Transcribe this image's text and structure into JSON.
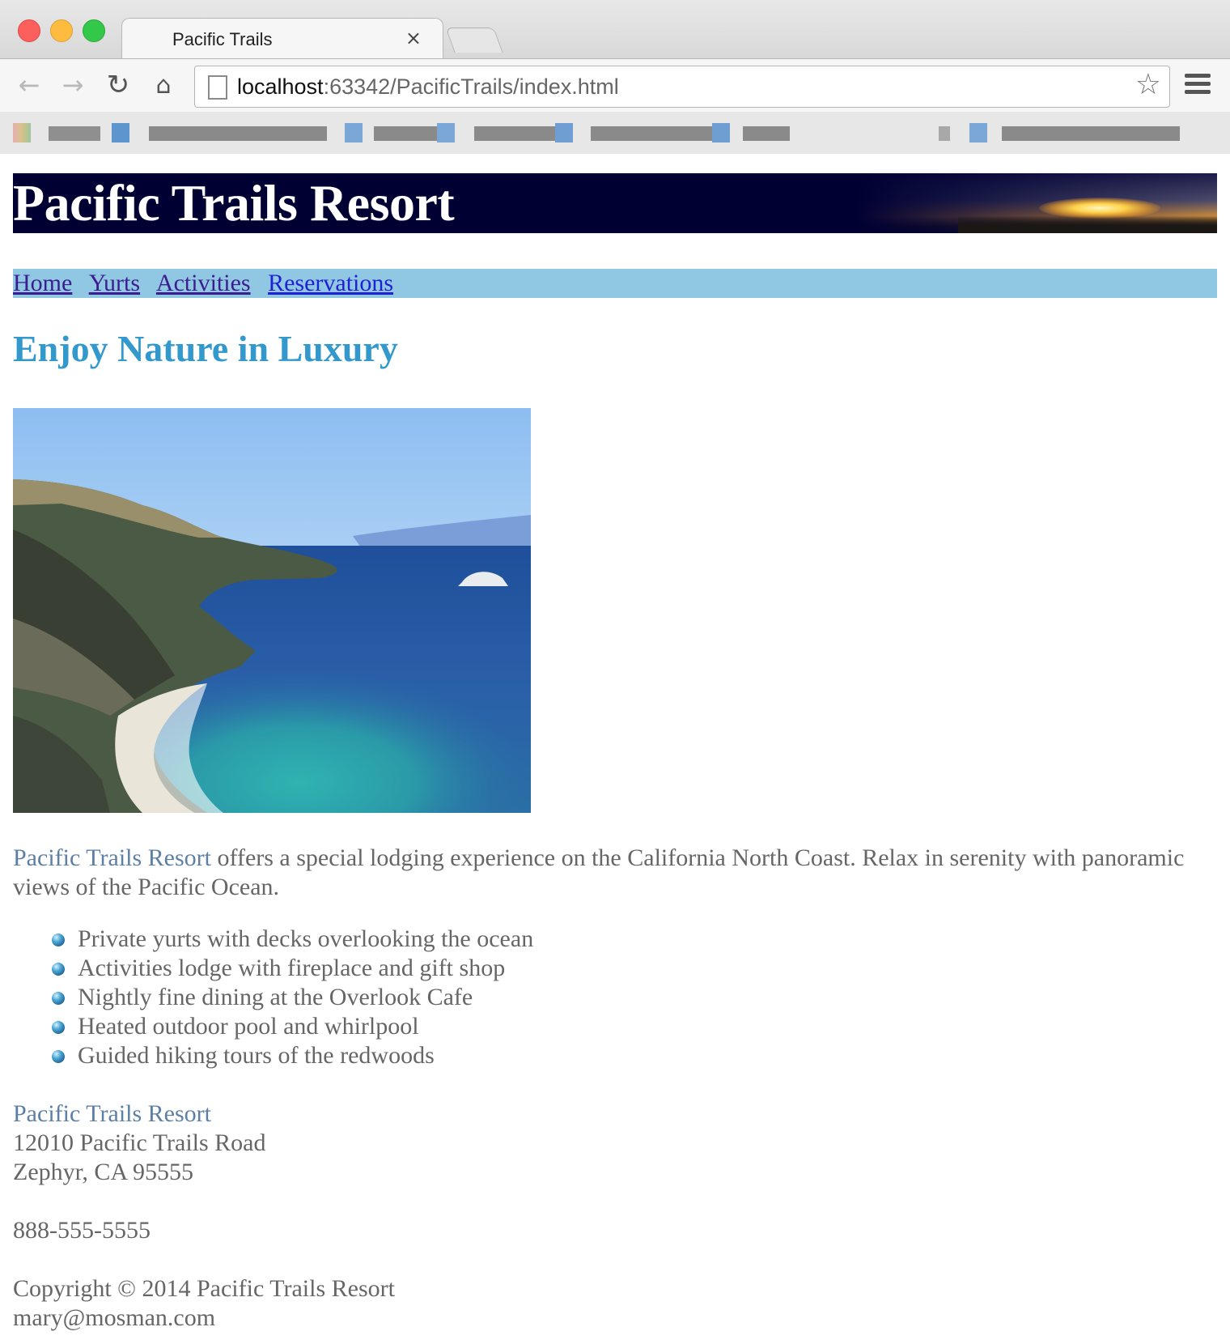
{
  "browser": {
    "tab_title": "Pacific Trails",
    "tab_close": "×",
    "url_host": "localhost",
    "url_rest": ":63342/PacificTrails/index.html"
  },
  "header": {
    "title": "Pacific Trails Resort"
  },
  "nav": {
    "items": [
      "Home",
      "Yurts",
      "Activities",
      "Reservations"
    ]
  },
  "main": {
    "heading": "Enjoy Nature in Luxury",
    "intro_highlight": "Pacific Trails Resort",
    "intro_text": " offers a special lodging experience on the California North Coast. Relax in serenity with panoramic views of the Pacific Ocean.",
    "features": [
      "Private yurts with decks overlooking the ocean",
      "Activities lodge with fireplace and gift shop",
      "Nightly fine dining at the Overlook Cafe",
      "Heated outdoor pool and whirlpool",
      "Guided hiking tours of the redwoods"
    ]
  },
  "contact": {
    "name": "Pacific Trails Resort",
    "street": "12010 Pacific Trails Road",
    "city": "Zephyr, CA 95555",
    "phone": "888-555-5555"
  },
  "footer": {
    "copyright": "Copyright © 2014 Pacific Trails Resort",
    "email": "mary@mosman.com"
  },
  "colors": {
    "banner_bg": "#000033",
    "nav_bg": "#90c7e3",
    "heading": "#3399cc",
    "body_text": "#666666",
    "highlight": "#5c7fa6"
  },
  "icons": [
    "back-arrow-icon",
    "forward-arrow-icon",
    "reload-icon",
    "home-icon",
    "page-icon",
    "bookmark-star-icon",
    "menu-icon",
    "bullet-sphere-icon"
  ]
}
